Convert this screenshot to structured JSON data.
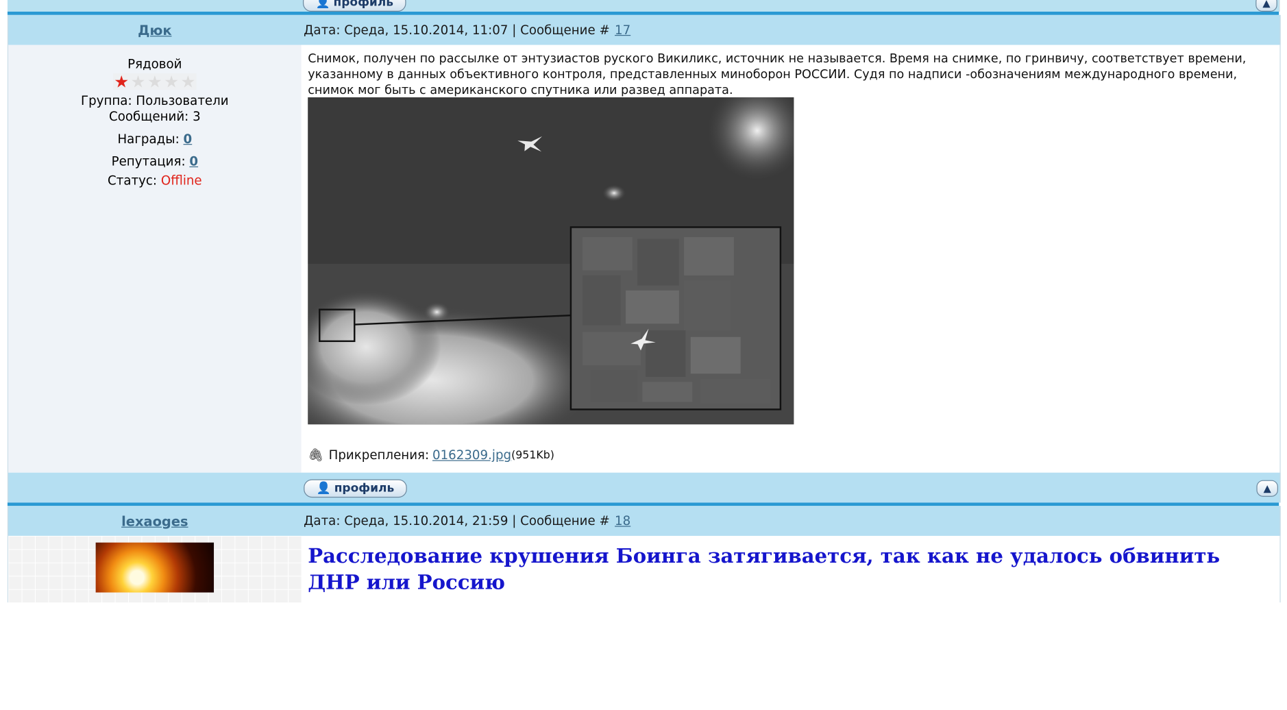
{
  "posts": [
    {
      "author": "Дюк",
      "date_line": "Дата: Среда, 15.10.2014, 11:07 | Сообщение #",
      "post_no": "17",
      "rank": "Рядовой",
      "group": "Группа: Пользователи",
      "messages": "Сообщений: 3",
      "awards_label": "Награды:",
      "awards_value": "0",
      "reputation_label": "Репутация:",
      "reputation_value": "0",
      "status_label": "Статус:",
      "status_value": "Offline",
      "text": "Снимок, получен по рассылке от энтузиастов руского Викиликс, источник не называется. Время на снимке, по гринвичу, соответствует времени, указанному в данных объективного контроля, представленных миноборон РОССИИ. Судя по надписи -обозначениям международного времени, снимок мог быть с американского спутника или развед аппарата.",
      "attach_label": "Прикрепления:",
      "attach_file": "0162309.jpg",
      "attach_size": "(951Kb)"
    },
    {
      "author": "lexaoges",
      "date_line": "Дата: Среда, 15.10.2014, 21:59 | Сообщение #",
      "post_no": "18",
      "headline": "Расследование крушения Боинга затягивается, так как не удалось обвинить ДНР или Россию"
    }
  ],
  "buttons": {
    "profile": "профиль"
  },
  "colors": {
    "header_bg": "#b5dff2",
    "separator": "#2a99d3",
    "link": "#3b6b8c",
    "offline": "#e0231a",
    "headline": "#1515cc"
  }
}
